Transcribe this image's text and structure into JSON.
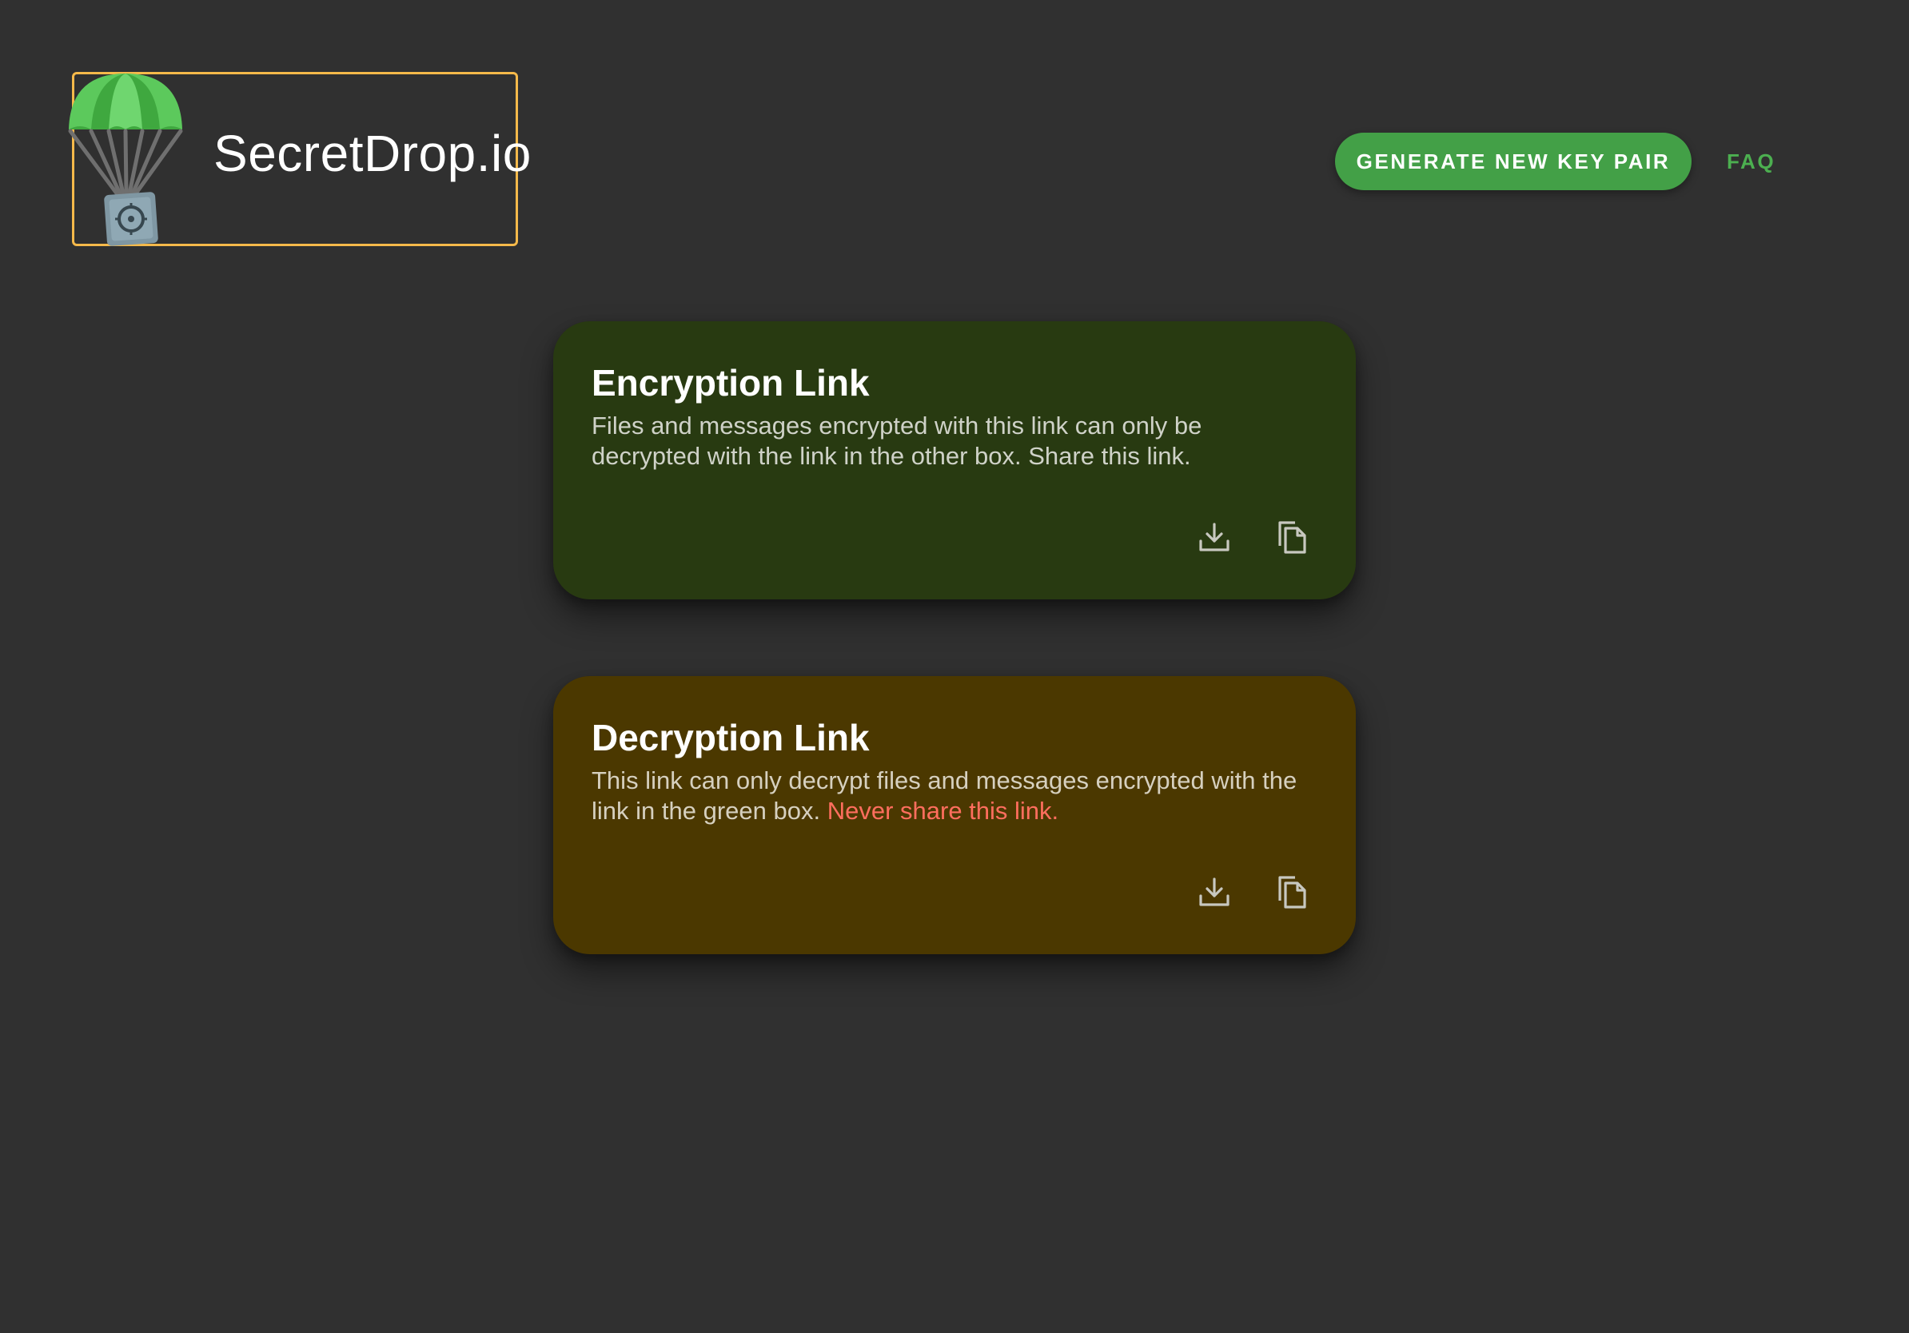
{
  "header": {
    "app_title": "SecretDrop.io",
    "logo_icon": "parachute-safe-icon",
    "generate_button_label": "GENERATE NEW KEY PAIR",
    "faq_link_label": "FAQ"
  },
  "colors": {
    "background": "#303030",
    "accent_green": "#43a047",
    "faq_green": "#4caf50",
    "logo_border": "#f5b94a",
    "encryption_card": "#283a11",
    "decryption_card": "#4b3800",
    "warning_text": "#ff6e5e"
  },
  "encryption_card": {
    "title": "Encryption Link",
    "description": "Files and messages encrypted with this link can only be decrypted with the link in the other box. Share this link.",
    "actions": [
      {
        "icon": "download-icon"
      },
      {
        "icon": "copy-icon"
      }
    ]
  },
  "decryption_card": {
    "title": "Decryption Link",
    "description": "This link can only decrypt files and messages encrypted with the link in the green box.",
    "warning": "Never share this link.",
    "actions": [
      {
        "icon": "download-icon"
      },
      {
        "icon": "copy-icon"
      }
    ]
  }
}
